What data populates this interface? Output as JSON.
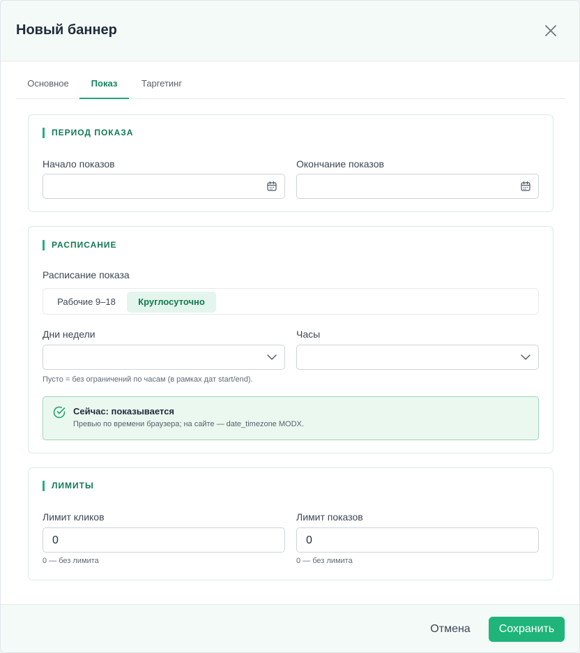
{
  "modal": {
    "title": "Новый баннер"
  },
  "tabs": [
    {
      "label": "Основное",
      "active": false
    },
    {
      "label": "Показ",
      "active": true
    },
    {
      "label": "Таргетинг",
      "active": false
    }
  ],
  "period": {
    "title": "ПЕРИОД ПОКАЗА",
    "start_label": "Начало показов",
    "start_value": "",
    "end_label": "Окончание показов",
    "end_value": ""
  },
  "schedule": {
    "title": "РАСПИСАНИЕ",
    "mode_label": "Расписание показа",
    "modes": [
      {
        "label": "Рабочие 9–18",
        "active": false
      },
      {
        "label": "Круглосуточно",
        "active": true
      }
    ],
    "days_label": "Дни недели",
    "days_value": "",
    "hours_label": "Часы",
    "hours_value": "",
    "hint": "Пусто = без ограничений по часам (в рамках дат start/end).",
    "status_title": "Сейчас: показывается",
    "status_sub": "Превью по времени браузера; на сайте — date_timezone MODX."
  },
  "limits": {
    "title": "ЛИМИТЫ",
    "clicks_label": "Лимит кликов",
    "clicks_value": "0",
    "clicks_hint": "0 — без лимита",
    "views_label": "Лимит показов",
    "views_value": "0",
    "views_hint": "0 — без лимита"
  },
  "footer": {
    "cancel_label": "Отмена",
    "save_label": "Сохранить"
  },
  "icons": {
    "close": "close-icon",
    "calendar": "calendar-icon",
    "chevron": "chevron-down-icon",
    "status": "check-circle-icon"
  },
  "colors": {
    "accent": "#1fb57a",
    "accent_dark": "#0f7a50",
    "status_bg": "#ebf8f0"
  }
}
